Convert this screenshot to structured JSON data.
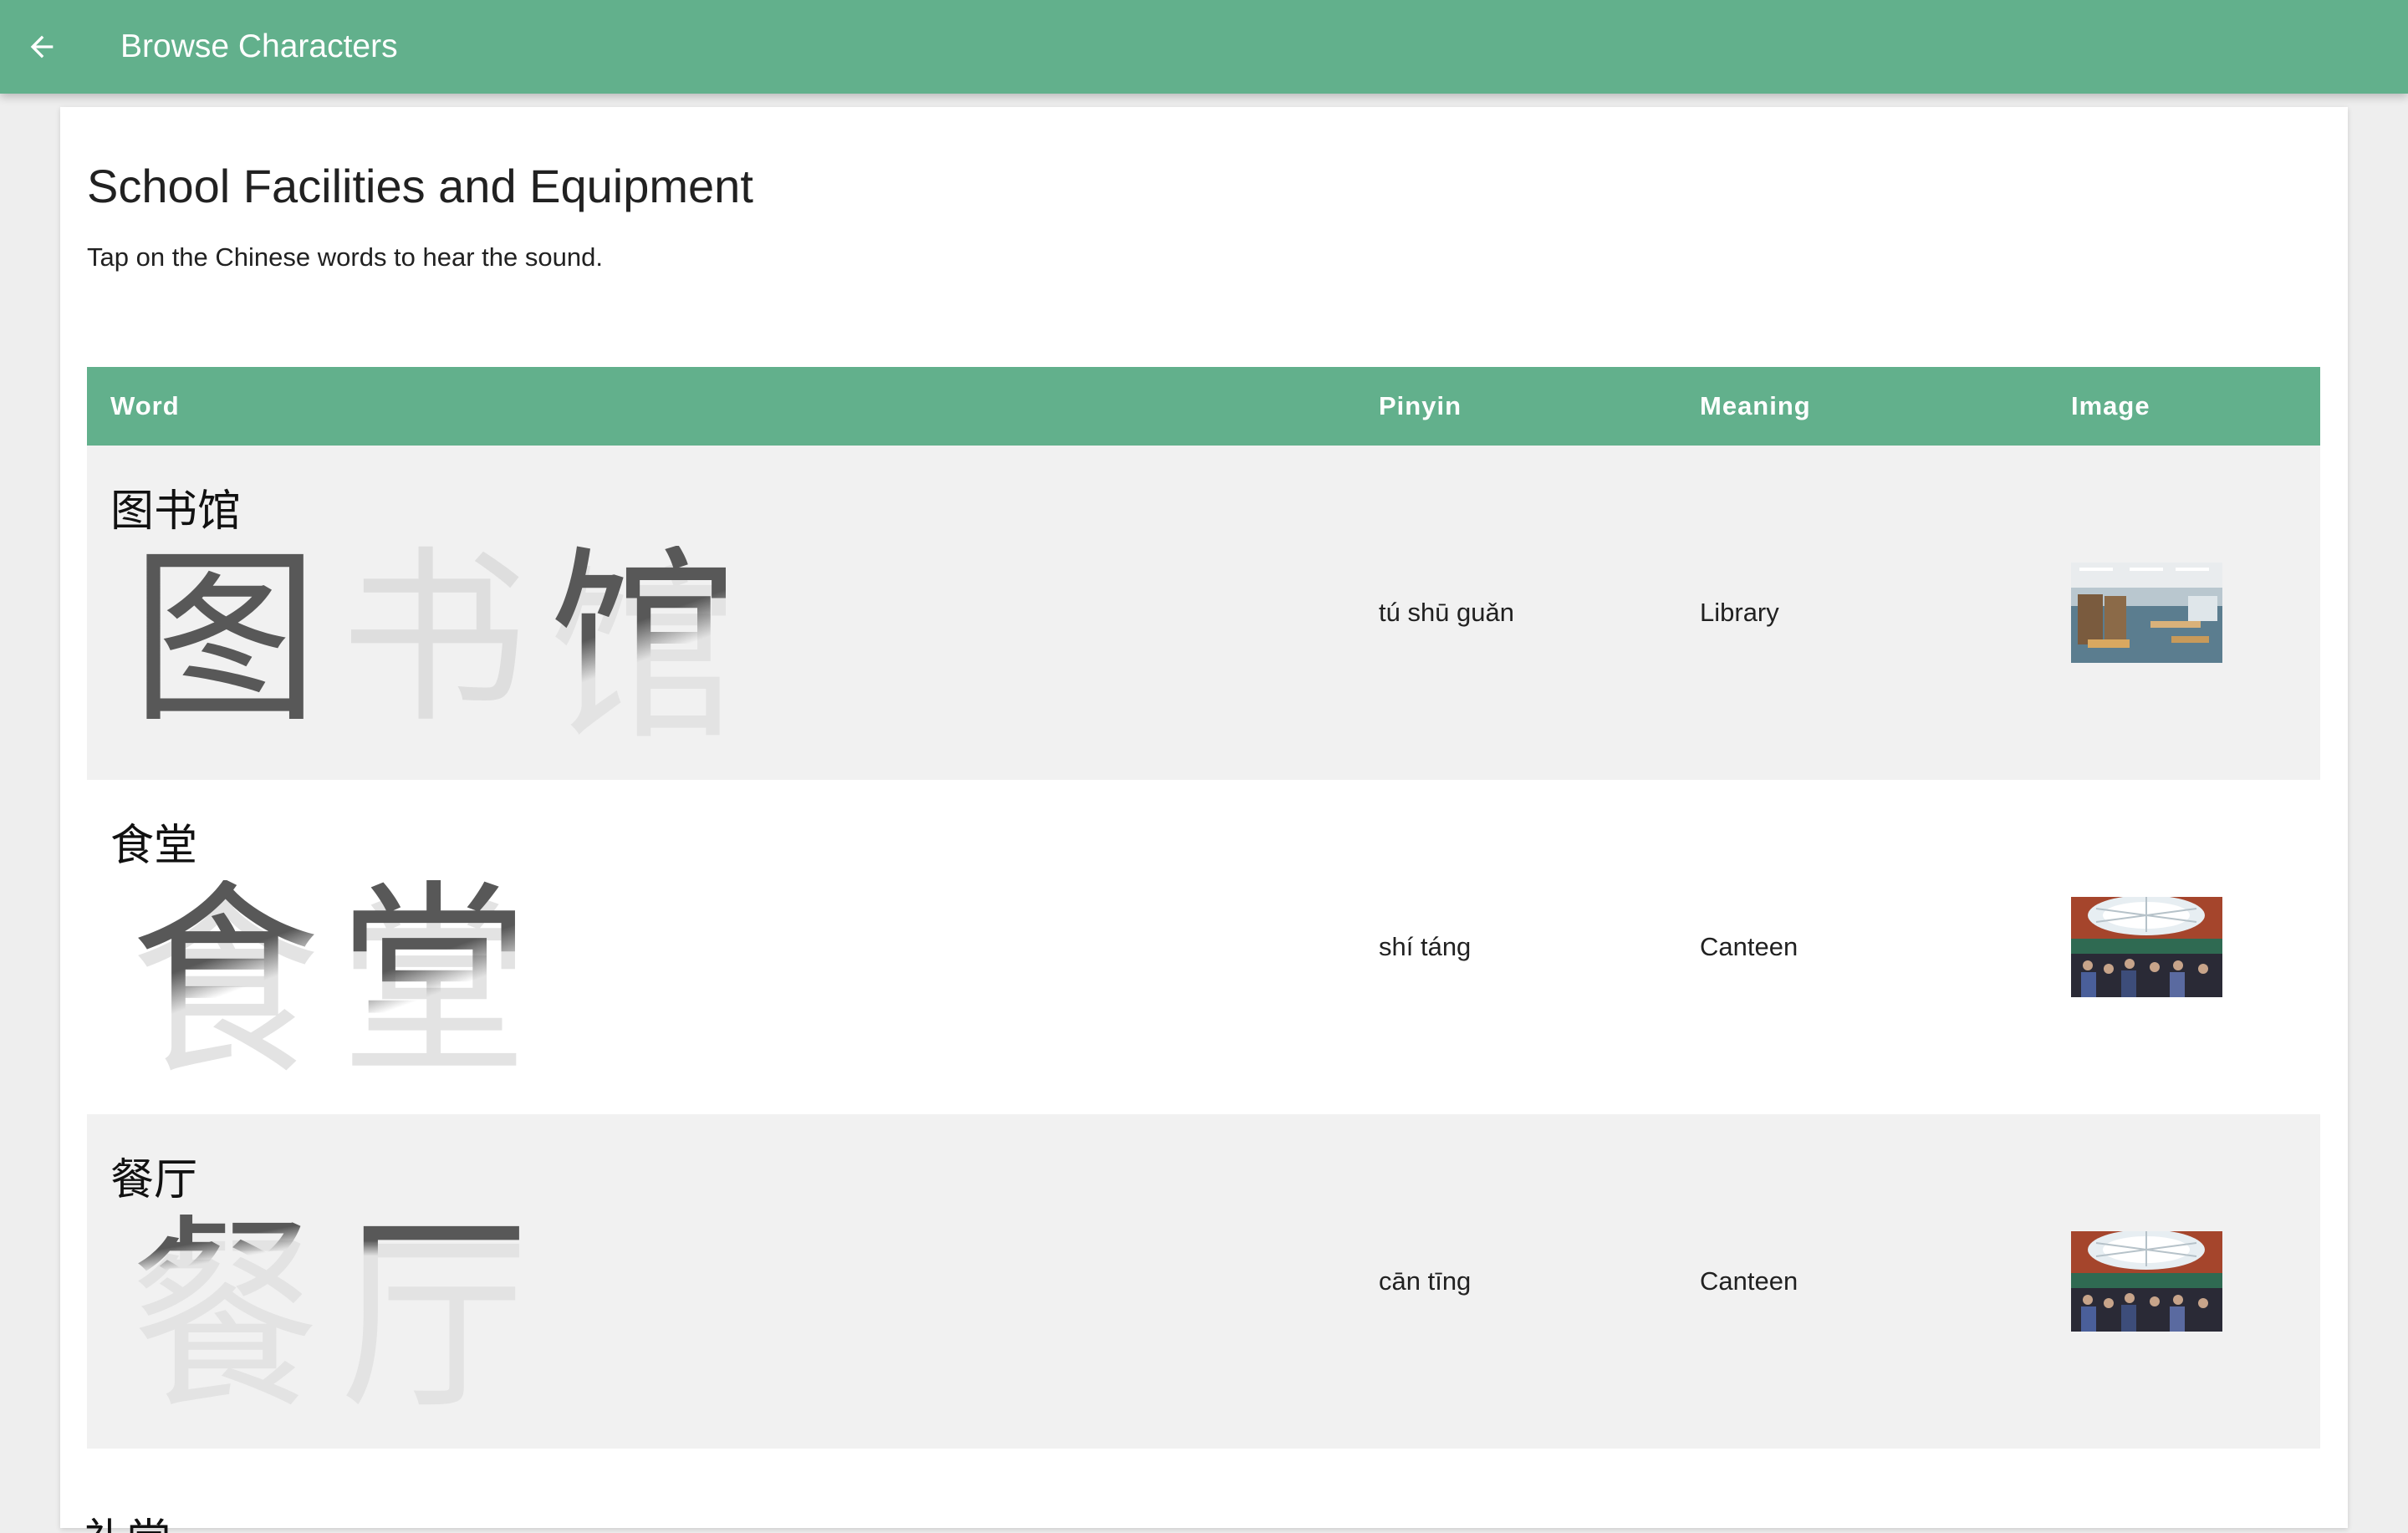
{
  "appbar": {
    "title": "Browse Characters",
    "back_icon": "arrow-left-icon",
    "color": "#62b08c"
  },
  "page": {
    "title": "School Facilities and Equipment",
    "subtitle": "Tap on the Chinese words to hear the sound."
  },
  "table": {
    "headers": {
      "word": "Word",
      "pinyin": "Pinyin",
      "meaning": "Meaning",
      "image": "Image"
    },
    "rows": [
      {
        "word": "图书馆",
        "chars": [
          "图",
          "书",
          "馆"
        ],
        "pinyin": "tú shū guǎn",
        "meaning": "Library",
        "image": "library-photo"
      },
      {
        "word": "食堂",
        "chars": [
          "食",
          "堂"
        ],
        "pinyin": "shí táng",
        "meaning": "Canteen",
        "image": "canteen-photo"
      },
      {
        "word": "餐厅",
        "chars": [
          "餐",
          "厅"
        ],
        "pinyin": "cān tīng",
        "meaning": "Canteen",
        "image": "canteen-photo"
      },
      {
        "word": "礼堂"
      }
    ]
  }
}
